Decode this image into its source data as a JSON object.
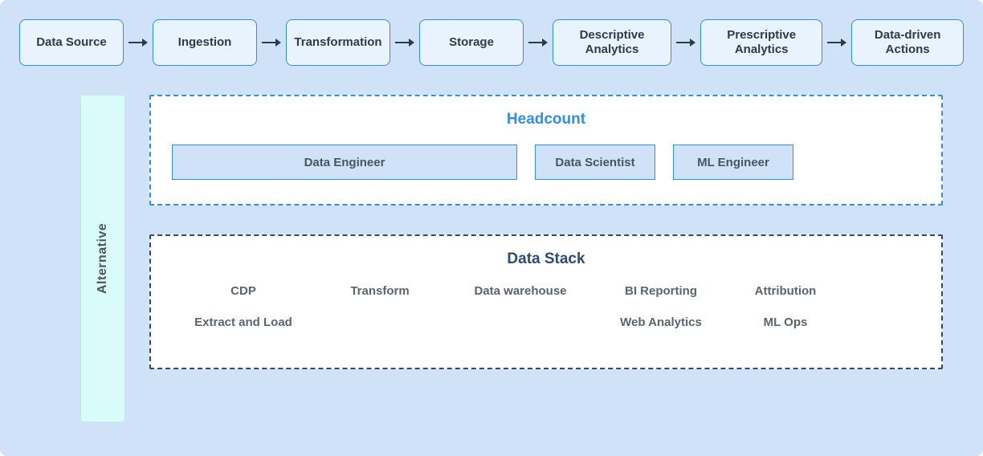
{
  "pipeline": {
    "steps": [
      "Data Source",
      "Ingestion",
      "Transformation",
      "Storage",
      "Descriptive Analytics",
      "Prescriptive Analytics",
      "Data-driven Actions"
    ]
  },
  "alternative_label": "Alternative",
  "headcount": {
    "title": "Headcount",
    "roles": {
      "data_engineer": "Data Engineer",
      "data_scientist": "Data Scientist",
      "ml_engineer": "ML Engineer"
    }
  },
  "data_stack": {
    "title": "Data Stack",
    "row1": {
      "c1": "CDP",
      "c2": "Transform",
      "c3": "Data warehouse",
      "c4": "BI Reporting",
      "c5": "Attribution"
    },
    "row2": {
      "c1": "Extract and Load",
      "c4": "Web Analytics",
      "c5": "ML Ops"
    }
  },
  "colors": {
    "canvas_bg": "#cfe2f7",
    "box_bg": "#e8f3fe",
    "border_blue": "#2f8fe8",
    "border_dark": "#2b4a7a",
    "alt_bg": "#d9fcfb"
  }
}
